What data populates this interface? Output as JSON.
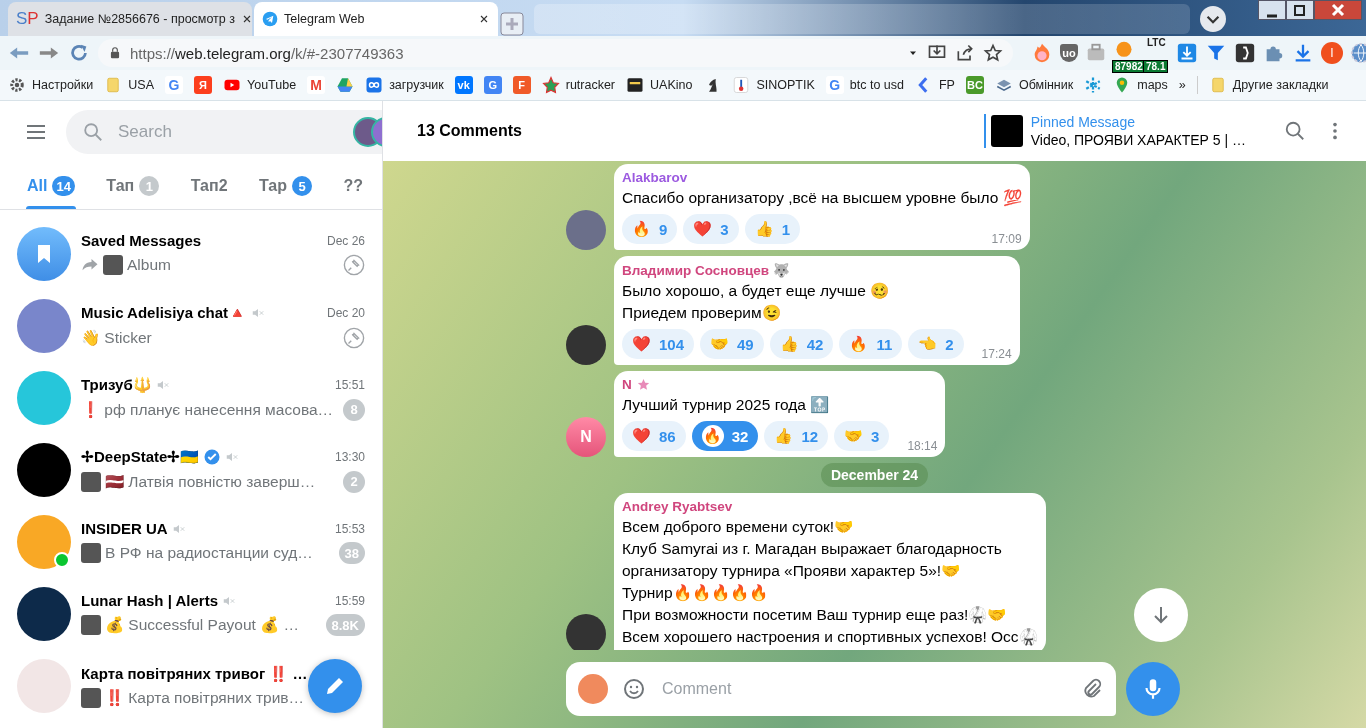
{
  "browser": {
    "tabs": [
      {
        "title": "Задание №2856676 - просмотр з",
        "glyph": "SP",
        "selected": false
      },
      {
        "title": "Telegram Web",
        "selected": true
      }
    ],
    "url_scheme": "https://",
    "url_host": "web.telegram.org",
    "url_path": "/k/#-2307749363",
    "bookmarks": [
      {
        "kind": "link",
        "label": "Настройки"
      },
      {
        "kind": "link",
        "label": "USA"
      },
      {
        "kind": "icon",
        "glyph": "G"
      },
      {
        "kind": "icon",
        "glyph": "Я"
      },
      {
        "kind": "link",
        "label": "YouTube"
      },
      {
        "kind": "icon",
        "glyph": "M"
      },
      {
        "kind": "icon"
      },
      {
        "kind": "link",
        "label": "загрузчик"
      },
      {
        "kind": "icon",
        "glyph": "vk"
      },
      {
        "kind": "icon",
        "glyph": "G"
      },
      {
        "kind": "icon",
        "glyph": "F"
      },
      {
        "kind": "link",
        "label": "rutracker"
      },
      {
        "kind": "link",
        "label": "UAKino"
      },
      {
        "kind": "icon"
      },
      {
        "kind": "link",
        "label": "SINOPTIK"
      },
      {
        "kind": "link",
        "glyph": "G",
        "label": "btc to usd"
      },
      {
        "kind": "link",
        "label": "FP"
      },
      {
        "kind": "icon",
        "glyph": "BC"
      },
      {
        "kind": "link",
        "label": "Обмінник"
      },
      {
        "kind": "icon"
      },
      {
        "kind": "link",
        "label": "maps"
      }
    ],
    "bookmarks_more": "»",
    "other_bookmarks": "Другие закладки",
    "extensions": [
      {
        "kind": "icon"
      },
      {
        "kind": "glyph",
        "glyph": "uo"
      },
      {
        "kind": "icon"
      },
      {
        "kind": "badge",
        "badge": "87982"
      },
      {
        "kind": "badge",
        "label": "LTC",
        "badge": "78.1"
      },
      {
        "kind": "icon"
      },
      {
        "kind": "icon"
      },
      {
        "kind": "icon"
      },
      {
        "kind": "icon"
      },
      {
        "kind": "icon"
      },
      {
        "kind": "avatar",
        "glyph": "I"
      },
      {
        "kind": "icon"
      }
    ]
  },
  "sidebar": {
    "search": {
      "placeholder": "Search"
    },
    "folders": [
      {
        "label": "All",
        "badge": "14",
        "badge_muted": false,
        "selected": true
      },
      {
        "label": "Тап",
        "badge": "1",
        "badge_muted": true,
        "selected": false
      },
      {
        "label": "Тап2",
        "selected": false
      },
      {
        "label": "Тар",
        "badge": "5",
        "badge_muted": false,
        "selected": false
      },
      {
        "label": "??",
        "selected": false
      }
    ],
    "chats": [
      {
        "kind": "saved",
        "name": "Saved Messages",
        "time": "Dec 26",
        "forwarded": true,
        "thumb": true,
        "preview": "Album",
        "muted": false,
        "pinned": true,
        "verified": false,
        "online": false
      },
      {
        "kind": "chat",
        "name": "Music Adelisiya chat🔺",
        "time": "Dec 20",
        "forwarded": false,
        "thumb": false,
        "preview": "👋 Sticker",
        "muted": true,
        "pinned": true,
        "verified": false,
        "online": false
      },
      {
        "kind": "chat",
        "name": "Тризуб🔱",
        "time": "15:51",
        "forwarded": false,
        "thumb": false,
        "preview": "❗ рф планує нанесення масова…",
        "muted": true,
        "pinned": false,
        "verified": false,
        "online": false,
        "unread": "8",
        "unread_muted": true
      },
      {
        "kind": "chat",
        "name": "✢DeepState✢🇺🇦",
        "time": "13:30",
        "forwarded": false,
        "thumb": true,
        "preview": "🇱🇻 Латвія повністю заверш…",
        "muted": true,
        "pinned": false,
        "verified": true,
        "online": false,
        "unread": "2",
        "unread_muted": true
      },
      {
        "kind": "chat",
        "name": "INSIDER UA",
        "time": "15:53",
        "forwarded": false,
        "thumb": true,
        "preview": "В РФ на радиостанции суд…",
        "muted": true,
        "pinned": false,
        "verified": false,
        "online": true,
        "unread": "38",
        "unread_muted": true
      },
      {
        "kind": "chat",
        "name": "Lunar Hash | Alerts",
        "time": "15:59",
        "forwarded": false,
        "thumb": true,
        "preview": "💰 Successful Payout 💰 …",
        "muted": true,
        "pinned": false,
        "verified": false,
        "online": false,
        "unread": "8.8K",
        "unread_muted": true
      },
      {
        "kind": "chat",
        "name": "Карта повітряних тривог ‼️ …",
        "forwarded": false,
        "thumb": true,
        "preview": "‼️ Карта повітряних трив…",
        "muted": false,
        "pinned": false,
        "verified": false,
        "online": false
      }
    ]
  },
  "chat": {
    "title": "13 Comments",
    "pinned": {
      "label": "Pinned Message",
      "text": "Video, ПРОЯВИ ХАРАКТЕР 5 | …"
    },
    "items": [
      {
        "kind": "message",
        "author": "Alakbarov",
        "color": "#9c5ae0",
        "text": "Спасибо организатору ,всё на высшем уровне было 💯",
        "time": "17:09",
        "reactions": [
          {
            "emoji": "🔥",
            "count": "9",
            "selected": false
          },
          {
            "emoji": "❤️",
            "count": "3",
            "selected": false
          },
          {
            "emoji": "👍",
            "count": "1",
            "selected": false
          }
        ]
      },
      {
        "kind": "message",
        "author": "Владимир Сосновцев 🐺",
        "color": "#d0467e",
        "text": "Было хорошо, а будет еще лучше 🥴\nПриедем проверим😉",
        "time": "17:24",
        "reactions": [
          {
            "emoji": "❤️",
            "count": "104",
            "selected": false
          },
          {
            "emoji": "🤝",
            "count": "49",
            "selected": false
          },
          {
            "emoji": "👍",
            "count": "42",
            "selected": false
          },
          {
            "emoji": "🔥",
            "count": "11",
            "selected": false
          },
          {
            "emoji": "👈",
            "count": "2",
            "selected": false
          }
        ]
      },
      {
        "kind": "message",
        "initial": "N",
        "author": "N",
        "status_star": true,
        "color": "#d0467e",
        "text": "Лучший турнир 2025 года 🔝",
        "time": "18:14",
        "reactions": [
          {
            "emoji": "❤️",
            "count": "86",
            "selected": false
          },
          {
            "emoji": "🔥",
            "count": "32",
            "selected": true
          },
          {
            "emoji": "👍",
            "count": "12",
            "selected": false
          },
          {
            "emoji": "🤝",
            "count": "3",
            "selected": false
          }
        ]
      },
      {
        "kind": "date",
        "text": "December 24"
      },
      {
        "kind": "message",
        "author": "Andrey Ryabtsev",
        "color": "#d0467e",
        "text": "Всем доброго времени суток!🤝\nКлуб Samyrai из г. Магадан выражает благодарность\nорганизатору турнира «Прояви характер 5»!🤝\nТурнир🔥🔥🔥🔥🔥\nПри возможности посетим Ваш турнир еще раз!🥋🤝\nВсем хорошего настроения и спортивных успехов! Осс🥋"
      }
    ],
    "composer": {
      "placeholder": "Comment"
    }
  }
}
